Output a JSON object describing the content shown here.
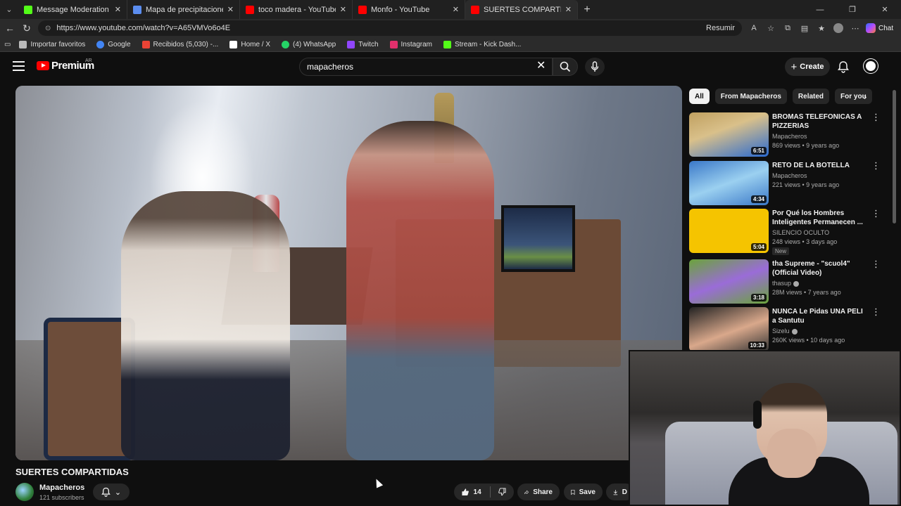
{
  "browser": {
    "tabs": [
      {
        "title": "Message Moderation - Kick Dashb",
        "favicon_color": "#53fc18",
        "active": false
      },
      {
        "title": "Mapa de precipitaciones de Lanús",
        "favicon_color": "#5b8def",
        "active": false
      },
      {
        "title": "toco madera - YouTube",
        "favicon_color": "#ff0000",
        "active": false
      },
      {
        "title": "Monfo - YouTube",
        "favicon_color": "#ff0000",
        "active": false
      },
      {
        "title": "SUERTES COMPARTIDAS - You",
        "favicon_color": "#ff0000",
        "active": true
      }
    ],
    "url": "https://www.youtube.com/watch?v=A65VMVo6o4E",
    "resumir_label": "Resumir",
    "chat_label": "Chat",
    "bookmarks": [
      {
        "label": "Importar favoritos",
        "color": "#bbbbbb"
      },
      {
        "label": "Google",
        "color": "#4285f4"
      },
      {
        "label": "Recibidos (5,030) -...",
        "color": "#ea4335"
      },
      {
        "label": "Home / X",
        "color": "#ffffff"
      },
      {
        "label": "(4) WhatsApp",
        "color": "#25d366"
      },
      {
        "label": "Twitch",
        "color": "#9146ff"
      },
      {
        "label": "Instagram",
        "color": "#e1306c"
      },
      {
        "label": "Stream - Kick Dash...",
        "color": "#53fc18"
      }
    ]
  },
  "header": {
    "logo_text": "Premium",
    "country_code": "AR",
    "search_value": "mapacheros",
    "create_label": "Create"
  },
  "video": {
    "title": "SUERTES COMPARTIDAS",
    "channel": "Mapacheros",
    "subscribers": "121 subscribers",
    "likes": "14",
    "share_label": "Share",
    "save_label": "Save",
    "download_label": "D"
  },
  "chips": [
    "All",
    "From Mapacheros",
    "Related",
    "For you"
  ],
  "recommendations": [
    {
      "title": "BROMAS TELEFONICAS A PIZZERIAS",
      "channel": "Mapacheros",
      "verified": false,
      "meta": "869 views • 9 years ago",
      "duration": "6:51",
      "thumb_colors": [
        "#c0a060",
        "#2a6ad0"
      ],
      "badge": ""
    },
    {
      "title": "RETO DE LA BOTELLA",
      "channel": "Mapacheros",
      "verified": false,
      "meta": "221 views • 9 years ago",
      "duration": "4:34",
      "thumb_colors": [
        "#3a78c8",
        "#9bd0f0"
      ],
      "badge": ""
    },
    {
      "title": "Por Qué los Hombres Inteligentes Permanecen ...",
      "channel": "SILENCIO OCULTO",
      "verified": false,
      "meta": "248 views • 3 days ago",
      "duration": "5:04",
      "thumb_colors": [
        "#f5c400",
        "#e8b800"
      ],
      "badge": "New"
    },
    {
      "title": "tha Supreme - \"scuol4\" (Official Video)",
      "channel": "thasup",
      "verified": true,
      "meta": "28M views • 7 years ago",
      "duration": "3:18",
      "thumb_colors": [
        "#9a6cd8",
        "#6aa43a"
      ],
      "badge": ""
    },
    {
      "title": "NUNCA Le Pidas UNA PELI a Santutu",
      "channel": "Sizelu",
      "verified": true,
      "meta": "260K views • 10 days ago",
      "duration": "10:33",
      "thumb_colors": [
        "#222222",
        "#d9a88b"
      ],
      "badge": ""
    }
  ]
}
